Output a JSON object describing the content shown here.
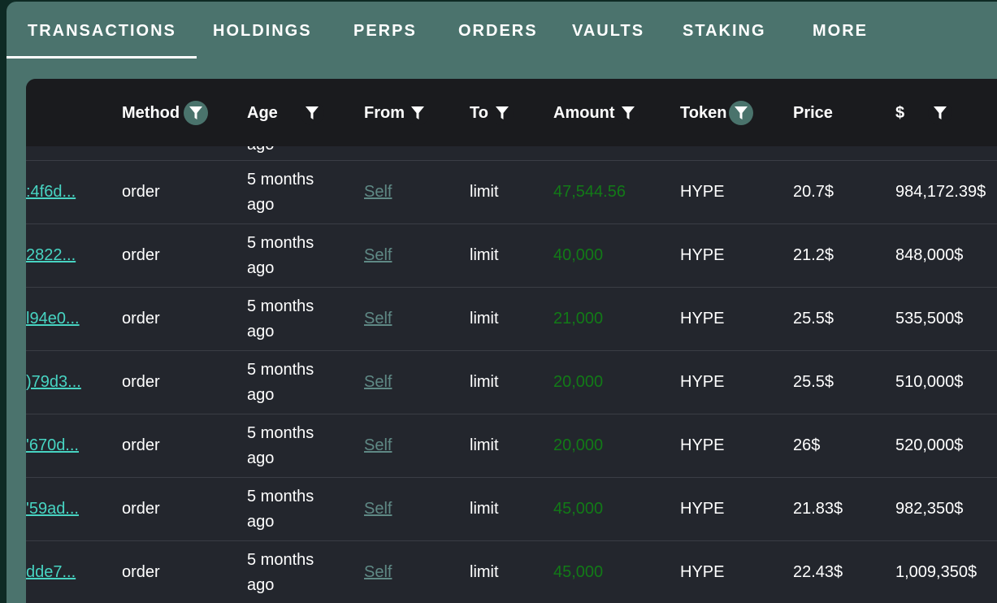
{
  "tabs": [
    {
      "label": "TRANSACTIONS",
      "active": true
    },
    {
      "label": "HOLDINGS"
    },
    {
      "label": "PERPS"
    },
    {
      "label": "ORDERS"
    },
    {
      "label": "VAULTS"
    },
    {
      "label": "STAKING"
    },
    {
      "label": "MORE"
    }
  ],
  "columns": {
    "method": "Method",
    "age": "Age",
    "from": "From",
    "to": "To",
    "amount": "Amount",
    "token": "Token",
    "price": "Price",
    "usd": "$"
  },
  "partial_row_age": "ago",
  "rows": [
    {
      "hash": ":4f6d...",
      "method": "order",
      "age": "5 months ago",
      "from": "Self",
      "to": "limit",
      "amount": "47,544.56",
      "token": "HYPE",
      "price": "20.7$",
      "usd": "984,172.39$"
    },
    {
      "hash": "2822...",
      "method": "order",
      "age": "5 months ago",
      "from": "Self",
      "to": "limit",
      "amount": "40,000",
      "token": "HYPE",
      "price": "21.2$",
      "usd": "848,000$"
    },
    {
      "hash": "l94e0...",
      "method": "order",
      "age": "5 months ago",
      "from": "Self",
      "to": "limit",
      "amount": "21,000",
      "token": "HYPE",
      "price": "25.5$",
      "usd": "535,500$"
    },
    {
      "hash": ")79d3...",
      "method": "order",
      "age": "5 months ago",
      "from": "Self",
      "to": "limit",
      "amount": "20,000",
      "token": "HYPE",
      "price": "25.5$",
      "usd": "510,000$"
    },
    {
      "hash": "'670d...",
      "method": "order",
      "age": "5 months ago",
      "from": "Self",
      "to": "limit",
      "amount": "20,000",
      "token": "HYPE",
      "price": "26$",
      "usd": "520,000$"
    },
    {
      "hash": "'59ad...",
      "method": "order",
      "age": "5 months ago",
      "from": "Self",
      "to": "limit",
      "amount": "45,000",
      "token": "HYPE",
      "price": "21.83$",
      "usd": "982,350$"
    },
    {
      "hash": "dde7...",
      "method": "order",
      "age": "5 months ago",
      "from": "Self",
      "to": "limit",
      "amount": "45,000",
      "token": "HYPE",
      "price": "22.43$",
      "usd": "1,009,350$"
    }
  ],
  "colors": {
    "accent": "#47d4c2",
    "amount": "#127a17",
    "tab_bar": "#4b736d",
    "table_bg": "#23262d",
    "header_bg": "#1a1b1e"
  },
  "icons": {
    "filter": "funnel-icon"
  }
}
